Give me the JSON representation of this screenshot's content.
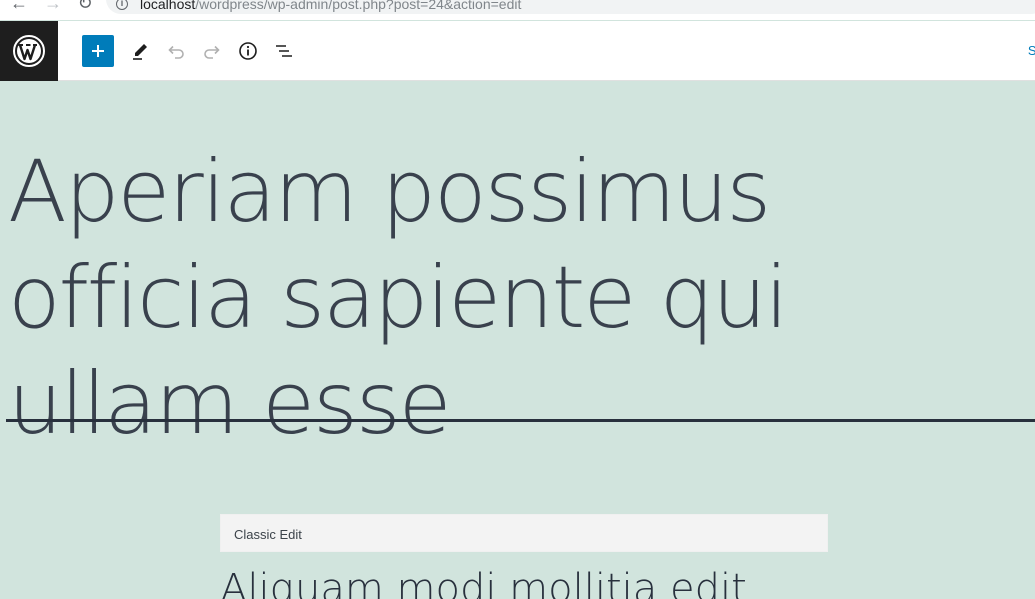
{
  "browser": {
    "url_host": "localhost",
    "url_path": "/wordpress/wp-admin/post.php?post=24&action=edit"
  },
  "header": {
    "right_link_label": "Sv",
    "icons": [
      "wordpress-logo-icon",
      "plus-icon",
      "pencil-icon",
      "undo-icon",
      "redo-icon",
      "info-icon",
      "list-view-icon"
    ],
    "accent_color": "#007cba"
  },
  "content": {
    "title": "Aperiam possimus officia sapiente qui ullam esse",
    "classic_block_label": "Classic Edit",
    "classic_heading": "Aliquam modi mollitia edit",
    "background_color": "#d1e4dd",
    "text_color": "#39414d"
  }
}
